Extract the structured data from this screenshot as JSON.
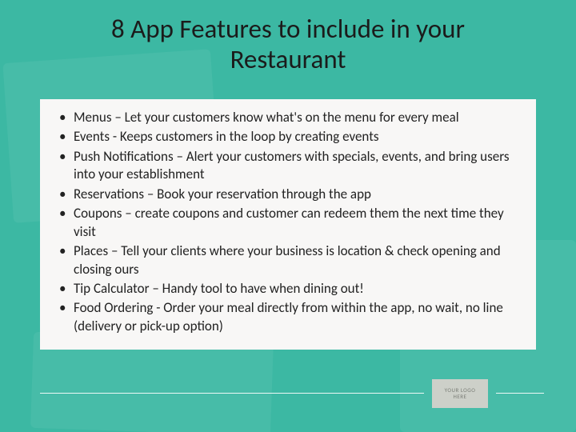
{
  "title_line1": "8 App Features to include in your",
  "title_line2": "Restaurant",
  "bullets": [
    "Menus – Let your customers know what's on the menu for every meal",
    "Events - Keeps customers in the loop by creating events",
    "Push Notifications – Alert your customers with specials, events, and bring users into your establishment",
    "Reservations – Book your reservation through the app",
    "Coupons – create coupons and customer can redeem them the next time they visit",
    "Places – Tell your clients where your business is location & check opening and closing ours",
    "Tip Calculator – Handy tool to have when dining out!",
    "Food Ordering -  Order your meal directly from within the app, no wait, no line (delivery or pick-up option)"
  ],
  "badge_line1": "YOUR LOGO",
  "badge_line2": "HERE"
}
